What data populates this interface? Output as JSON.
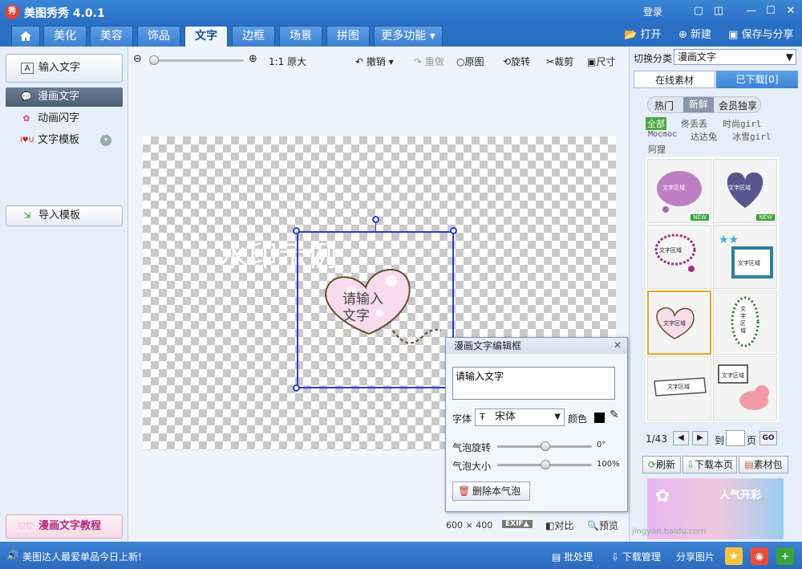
{
  "titlebar": {
    "title": "美图秀秀 4.0.1",
    "login": "登录"
  },
  "menu": {
    "tabs": [
      "美化",
      "美容",
      "饰品",
      "文字",
      "边框",
      "场景",
      "拼图",
      "更多功能"
    ],
    "active_index": 3,
    "open": "打开",
    "new": "新建",
    "save_share": "保存与分享"
  },
  "sidebar": {
    "input_text": "输入文字",
    "comic_text": "漫画文字",
    "animated_text": "动画闪字",
    "text_template": "文字模板",
    "import_template": "导入模板",
    "tutorial": "漫画文字教程"
  },
  "toolbar": {
    "original_size": "1:1 原大",
    "undo": "撤销",
    "redo": "重做",
    "original": "原图",
    "rotate": "旋转",
    "crop": "裁剪",
    "size": "尺寸"
  },
  "canvas": {
    "watermark": "水印示例",
    "bubble_text": "请输入\n文字",
    "dimensions": "600 × 400",
    "exif": "EXIF",
    "compare": "对比",
    "preview": "预览"
  },
  "right": {
    "switch_label": "切换分类",
    "category": "漫画文字",
    "tabs": [
      "在线素材",
      "已下载[0]"
    ],
    "filters": [
      "热门",
      "新鲜",
      "会员独享"
    ],
    "tags": [
      "全部",
      "佟丢丢",
      "时尚girl",
      "Mocmoc",
      "达达兔",
      "冰雪girl",
      "阿狸"
    ],
    "thumb_text": "文字区域",
    "new_tag": "NEW",
    "page": "1/43",
    "goto": "到",
    "page_unit": "页",
    "go": "GO",
    "refresh": "刷新",
    "download_page": "下载本页",
    "material_pack": "素材包",
    "banner": "人气开彩"
  },
  "dialog": {
    "title": "漫画文字编辑框",
    "text": "请输入文字",
    "font_label": "字体",
    "font": "宋体",
    "color_label": "颜色",
    "rotate_label": "气泡旋转",
    "rotate_value": "0°",
    "size_label": "气泡大小",
    "size_value": "100%",
    "delete": "删除本气泡"
  },
  "status": {
    "news": "美图达人最爱单品今日上新!",
    "batch": "批处理",
    "download_mgr": "下载管理",
    "share_pic": "分享图片",
    "watermark_site": "jingyan.baidu.com"
  }
}
